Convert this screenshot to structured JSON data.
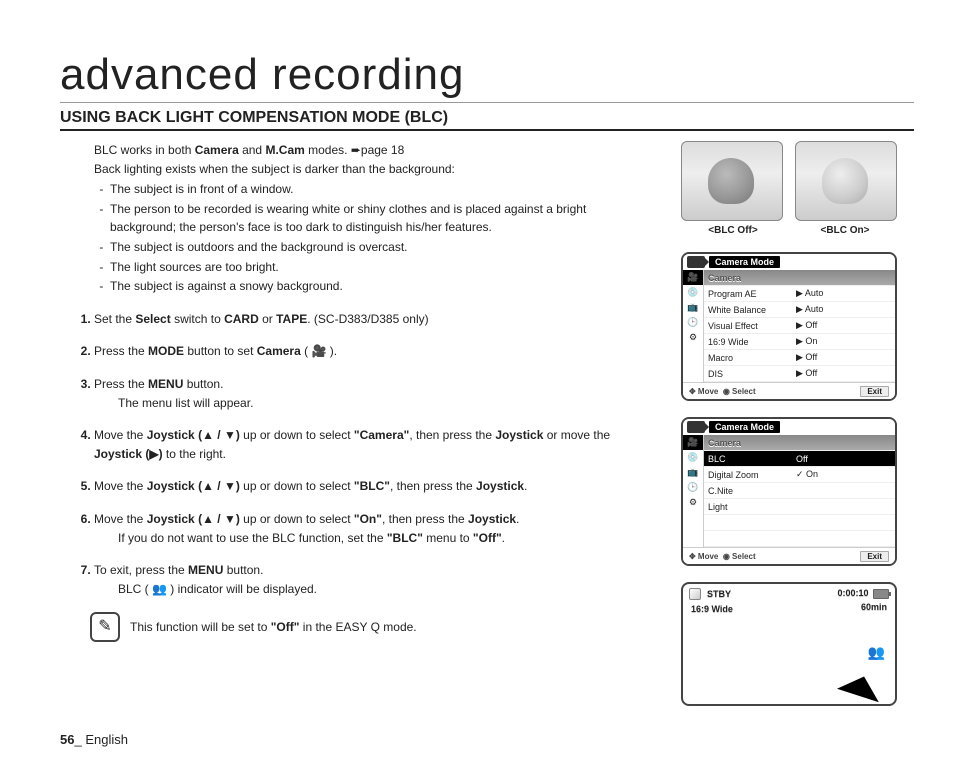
{
  "title": "advanced recording",
  "subtitle": "USING BACK LIGHT COMPENSATION MODE (BLC)",
  "intro": {
    "line1a": "BLC works in both ",
    "line1b": "Camera",
    "line1c": " and ",
    "line1d": "M.Cam",
    "line1e": " modes. ",
    "pageref": "page 18",
    "line2": "Back lighting exists when the subject is darker than the background:"
  },
  "bullets": [
    "The subject is in front of a window.",
    "The person to be recorded is wearing white or shiny clothes and is placed against a bright background; the person's face is too dark to distinguish his/her features.",
    "The subject is outdoors and the background is overcast.",
    "The light sources are too bright.",
    "The subject is against a snowy background."
  ],
  "steps": [
    {
      "pre": "Set the ",
      "b1": "Select",
      "mid1": " switch to ",
      "b2": "CARD",
      "mid2": " or ",
      "b3": "TAPE",
      "post": ". (SC-D383/D385 only)"
    },
    {
      "pre": "Press the ",
      "b1": "MODE",
      "mid1": " button to set ",
      "b2": "Camera",
      "post": " ( 🎥 )."
    },
    {
      "pre": "Press the ",
      "b1": "MENU",
      "post": " button.",
      "sub": "The menu list will appear."
    },
    {
      "pre": "Move the ",
      "b1": "Joystick (▲ / ▼)",
      "mid1": " up or down to select ",
      "b2": "\"Camera\"",
      "mid2": ", then press the ",
      "b3": "Joystick",
      "mid3": " or move the ",
      "b4": "Joystick (▶)",
      "post": " to the right."
    },
    {
      "pre": "Move the ",
      "b1": "Joystick (▲ / ▼)",
      "mid1": " up or down to select ",
      "b2": "\"BLC\"",
      "mid2": ", then press the ",
      "b3": "Joystick",
      "post": "."
    },
    {
      "pre": "Move the ",
      "b1": "Joystick (▲ / ▼)",
      "mid1": " up or down to select ",
      "b2": "\"On\"",
      "mid2": ", then press the ",
      "b3": "Joystick",
      "post": ".",
      "sub_pre": "If you do not want to use the BLC function, set the ",
      "sub_b1": "\"BLC\"",
      "sub_mid": " menu to ",
      "sub_b2": "\"Off\"",
      "sub_post": "."
    },
    {
      "pre": "To exit, press the ",
      "b1": "MENU",
      "post": " button.",
      "sub": "BLC ( 👥 ) indicator will be displayed."
    }
  ],
  "note": {
    "pre": "This function will be set to ",
    "b": "\"Off\"",
    "post": " in the EASY Q mode."
  },
  "footer": {
    "page": "56",
    "sep": "_ ",
    "lang": "English"
  },
  "photos": {
    "off": "<BLC Off>",
    "on": "<BLC On>"
  },
  "menu1": {
    "mode": "Camera Mode",
    "header": "Camera",
    "rows": [
      {
        "lbl": "Program AE",
        "val": "▶ Auto"
      },
      {
        "lbl": "White Balance",
        "val": "▶ Auto"
      },
      {
        "lbl": "Visual Effect",
        "val": "▶ Off"
      },
      {
        "lbl": "16:9 Wide",
        "val": "▶ On"
      },
      {
        "lbl": "Macro",
        "val": "▶ Off"
      },
      {
        "lbl": "DIS",
        "val": "▶ Off"
      }
    ],
    "foot": {
      "move": "✥ Move",
      "select": "◉ Select",
      "exit": "Exit"
    }
  },
  "menu2": {
    "mode": "Camera Mode",
    "header": "Camera",
    "rows": [
      {
        "lbl": "BLC",
        "val": "Off",
        "selected": true
      },
      {
        "lbl": "Digital Zoom",
        "val": "✓ On"
      },
      {
        "lbl": "C.Nite",
        "val": ""
      },
      {
        "lbl": "Light",
        "val": ""
      },
      {
        "lbl": "",
        "val": ""
      },
      {
        "lbl": "",
        "val": ""
      }
    ],
    "foot": {
      "move": "✥ Move",
      "select": "◉ Select",
      "exit": "Exit"
    }
  },
  "status": {
    "stby": "STBY",
    "time": "0:00:10",
    "wide": "16:9 Wide",
    "min": "60min"
  }
}
